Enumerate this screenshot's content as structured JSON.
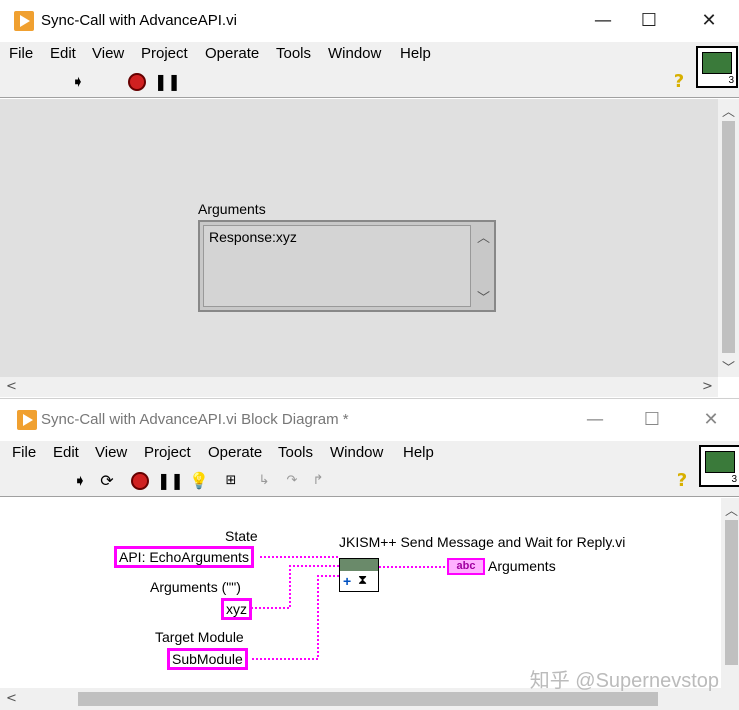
{
  "front_panel": {
    "title": "Sync-Call with AdvanceAPI.vi",
    "menu": [
      "File",
      "Edit",
      "View",
      "Project",
      "Operate",
      "Tools",
      "Window",
      "Help"
    ],
    "connector_number": "3",
    "arguments_label": "Arguments",
    "arguments_value": "Response:xyz"
  },
  "block_diagram": {
    "title": "Sync-Call with AdvanceAPI.vi Block Diagram *",
    "menu": [
      "File",
      "Edit",
      "View",
      "Project",
      "Operate",
      "Tools",
      "Window",
      "Help"
    ],
    "connector_number": "3",
    "state_label": "State",
    "state_value": "API: EchoArguments",
    "arguments_label": "Arguments (\"\")",
    "arguments_value": "xyz",
    "target_label": "Target Module",
    "target_value": "SubModule",
    "subvi_label": "JKISM++ Send Message and Wait for Reply.vi",
    "indicator_text": "abc",
    "indicator_label": "Arguments",
    "watermark": "知乎 @Supernevstop"
  },
  "window_controls": {
    "minimize": "—",
    "maximize": "☐",
    "close": "✕"
  }
}
